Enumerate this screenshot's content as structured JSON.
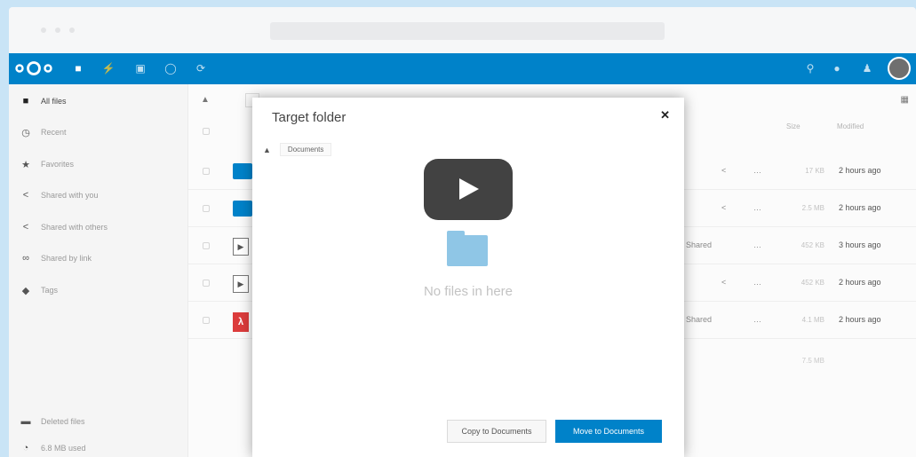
{
  "header": {
    "nav_icons": [
      "files-icon",
      "activity-icon",
      "gallery-icon",
      "search-circle-icon",
      "sync-icon"
    ],
    "right_icons": [
      "search-icon",
      "notifications-icon",
      "contacts-icon"
    ]
  },
  "sidebar": {
    "items": [
      {
        "label": "All files",
        "icon": "folder-icon"
      },
      {
        "label": "Recent",
        "icon": "clock-icon"
      },
      {
        "label": "Favorites",
        "icon": "star-icon"
      },
      {
        "label": "Shared with you",
        "icon": "share-icon"
      },
      {
        "label": "Shared with others",
        "icon": "share-icon"
      },
      {
        "label": "Shared by link",
        "icon": "link-icon"
      },
      {
        "label": "Tags",
        "icon": "tag-icon"
      }
    ],
    "footer": [
      {
        "label": "Deleted files",
        "icon": "trash-icon"
      },
      {
        "label": "6.8 MB used",
        "icon": "quota-icon"
      }
    ]
  },
  "file_list": {
    "headers": {
      "size": "Size",
      "modified": "Modified"
    },
    "rows": [
      {
        "type": "folder",
        "shared": "",
        "size": "17 KB",
        "modified": "2 hours ago"
      },
      {
        "type": "folder",
        "shared": "",
        "size": "2.5 MB",
        "modified": "2 hours ago"
      },
      {
        "type": "video",
        "shared": "Shared",
        "size": "452 KB",
        "modified": "3 hours ago"
      },
      {
        "type": "video",
        "shared": "",
        "size": "452 KB",
        "modified": "2 hours ago"
      },
      {
        "type": "pdf",
        "shared": "Shared",
        "size": "4.1 MB",
        "modified": "2 hours ago"
      }
    ],
    "total_size": "7.5 MB",
    "more_label": "…"
  },
  "modal": {
    "title": "Target folder",
    "close": "✕",
    "crumb": "Documents",
    "empty_text": "No files in here",
    "copy_label": "Copy to Documents",
    "move_label": "Move to Documents"
  }
}
